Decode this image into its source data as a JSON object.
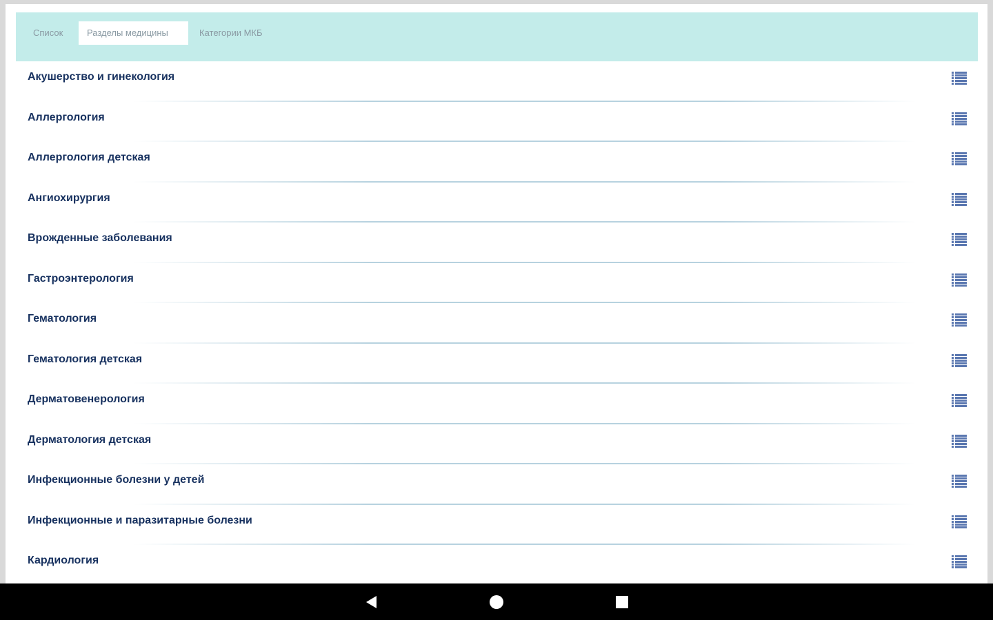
{
  "tabs": [
    {
      "label": "Список",
      "active": false
    },
    {
      "label": "Разделы медицины",
      "active": true
    },
    {
      "label": "Категории МКБ",
      "active": false
    }
  ],
  "sections": [
    "Акушерство и гинекология",
    "Аллергология",
    "Аллергология детская",
    "Ангиохирургия",
    "Врожденные заболевания",
    "Гастроэнтерология",
    "Гематология",
    "Гематология детская",
    "Дерматовенерология",
    "Дерматология детская",
    "Инфекционные болезни у детей",
    "Инфекционные и паразитарные болезни",
    "Кардиология"
  ],
  "row_icon": "list-icon",
  "colors": {
    "tab_bar": "#c3ecea",
    "row_text": "#17315f",
    "icon": "#5a77b0",
    "divider": "#b7d2df",
    "nav_bar": "#000000"
  },
  "nav_bar": {
    "icons": [
      "back-icon",
      "home-icon",
      "recents-icon"
    ]
  }
}
